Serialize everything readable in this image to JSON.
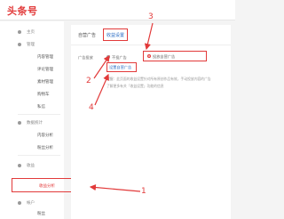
{
  "app": {
    "logo": "头条号"
  },
  "sidebar": {
    "items": [
      {
        "label": "主页"
      },
      {
        "label": "管理"
      },
      {
        "label": "内容管理"
      },
      {
        "label": "评论管理"
      },
      {
        "label": "素材管理"
      },
      {
        "label": "购物车"
      },
      {
        "label": "私信"
      },
      {
        "label": "数据统计"
      },
      {
        "label": "内容分析"
      },
      {
        "label": "粉丝分析"
      },
      {
        "label": "收益"
      },
      {
        "label": "收益分析"
      },
      {
        "label": "帐户"
      },
      {
        "label": "粉丝"
      }
    ]
  },
  "tabs": [
    {
      "label": "自营广告"
    },
    {
      "label": "收益设置"
    }
  ],
  "settings": {
    "ad_label": "广告投放",
    "option_off": "不投广告",
    "option_on": "投放自营广告",
    "link": "设置自营广告",
    "hint": "提醒：此页面的收益设置针对所有原创作品有效，手动投放内容的广告",
    "hint2": "了解更多有关「收益设置」功能的信息"
  },
  "annotations": [
    "1",
    "2",
    "3",
    "4"
  ],
  "colors": {
    "accent": "#e23a3a",
    "link": "#2a6cc4"
  }
}
